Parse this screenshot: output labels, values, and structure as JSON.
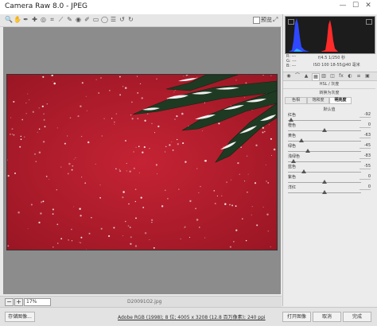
{
  "window": {
    "title": "Camera Raw 8.0  -  JPEG",
    "minimize": "—",
    "maximize": "☐",
    "close": "✕"
  },
  "toolbar": {
    "tools": [
      "zoom-icon",
      "hand-icon",
      "white-balance-icon",
      "color-sampler-icon",
      "targeted-adjustment-icon",
      "crop-icon",
      "straighten-icon",
      "spot-removal-icon",
      "red-eye-icon",
      "adjustment-brush-icon",
      "graduated-filter-icon",
      "radial-filter-icon",
      "preferences-icon",
      "rotate-ccw-icon",
      "rotate-cw-icon"
    ],
    "tool_glyphs": [
      "🔍",
      "✋",
      "✒",
      "✚",
      "◎",
      "⌗",
      "⟋",
      "✎",
      "◉",
      "✐",
      "▭",
      "◯",
      "☰",
      "↺",
      "↻"
    ],
    "preview_label": "预览"
  },
  "status": {
    "zoom_minus": "−",
    "zoom_plus": "+",
    "zoom_value": "17%",
    "filename": "D20091O2.jpg"
  },
  "bottom": {
    "save_label": "存储图像...",
    "workflow_info": "Adobe RGB (1998); 8 位; 4005 x 3208 (12.8 百万像素); 240 ppi",
    "open_label": "打开图像",
    "cancel_label": "取消",
    "done_label": "完成"
  },
  "histogram": {
    "colors": {
      "background": "#1c1c1c",
      "blue": "#2f48ff",
      "red": "#ff2a2a"
    }
  },
  "camera_info": {
    "r_label": "R:  ---",
    "g_label": "G:  ---",
    "b_label": "B:  ---",
    "aperture_shutter": "f/4.5   1/250 秒",
    "iso_lens": "ISO 100   18-55@40 毫米"
  },
  "panel": {
    "section_title": "HSL / 灰度",
    "convert_gray_label": "转换为灰度",
    "subtabs": [
      "色相",
      "饱和度",
      "明亮度"
    ],
    "active_subtab": 2,
    "default_label": "默认值",
    "sliders": [
      {
        "label": "红色",
        "value": "-92",
        "pos": 0.04
      },
      {
        "label": "橙色",
        "value": "0",
        "pos": 0.5
      },
      {
        "label": "黄色",
        "value": "-63",
        "pos": 0.18
      },
      {
        "label": "绿色",
        "value": "-45",
        "pos": 0.27
      },
      {
        "label": "浅绿色",
        "value": "-83",
        "pos": 0.08
      },
      {
        "label": "蓝色",
        "value": "-55",
        "pos": 0.22
      },
      {
        "label": "紫色",
        "value": "0",
        "pos": 0.5
      },
      {
        "label": "洋红",
        "value": "0",
        "pos": 0.5
      }
    ]
  }
}
